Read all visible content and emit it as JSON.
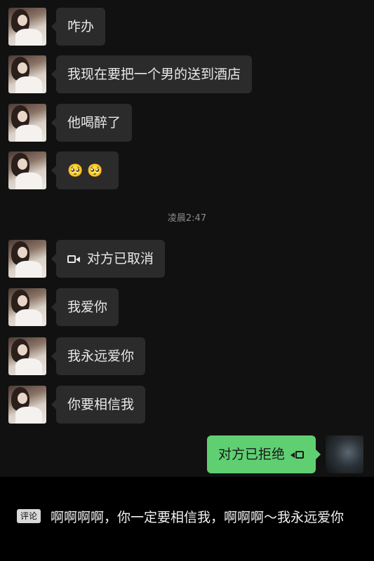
{
  "messages": [
    {
      "text": "咋办"
    },
    {
      "text": "我现在要把一个男的送到酒店"
    },
    {
      "text": "他喝醉了"
    },
    {
      "text": "🥺🥺",
      "icon": "crying-face-emoji"
    }
  ],
  "timestamp": "凌晨2:47",
  "messages2": [
    {
      "text": "对方已取消",
      "icon": "video-call-icon"
    },
    {
      "text": "我爱你"
    },
    {
      "text": "我永远爱你"
    },
    {
      "text": "你要相信我"
    }
  ],
  "sent": {
    "text": "对方已拒绝",
    "icon": "video-call-icon"
  },
  "comment": {
    "tag": "评论",
    "text": "啊啊啊啊，你一定要相信我，啊啊啊～我永远爱你"
  },
  "colors": {
    "background": "#111111",
    "incoming_bubble": "#2b2b2b",
    "outgoing_bubble": "#5fcf72"
  }
}
